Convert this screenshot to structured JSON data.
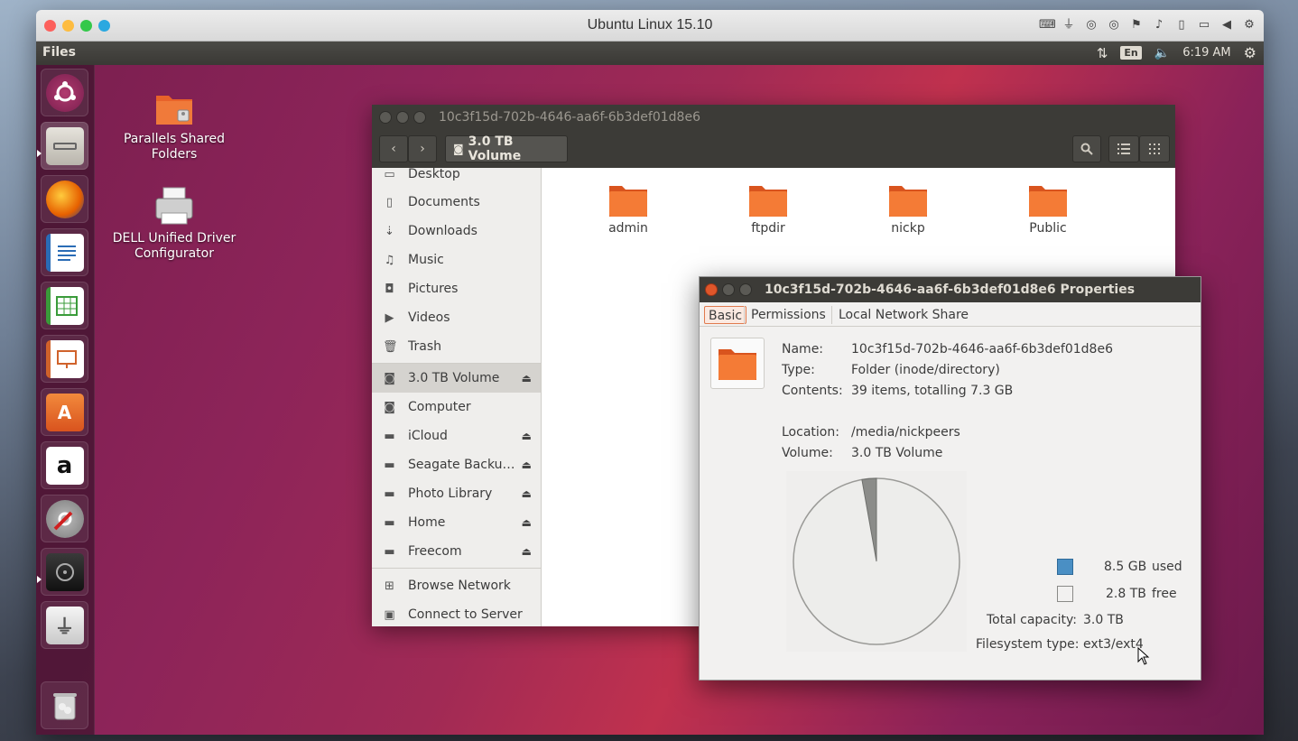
{
  "mac": {
    "title": "Ubuntu Linux 15.10"
  },
  "panel": {
    "app_name": "Files",
    "lang": "En",
    "time": "6:19 AM"
  },
  "desktop_icons": [
    {
      "label_line1": "Parallels Shared",
      "label_line2": "Folders"
    },
    {
      "label_line1": "DELL Unified Driver",
      "label_line2": "Configurator"
    }
  ],
  "launcher": [
    {
      "name": "ubuntu-dash-icon"
    },
    {
      "name": "files-icon"
    },
    {
      "name": "firefox-icon"
    },
    {
      "name": "writer-icon"
    },
    {
      "name": "calc-icon"
    },
    {
      "name": "impress-icon"
    },
    {
      "name": "software-center-icon"
    },
    {
      "name": "amazon-icon"
    },
    {
      "name": "system-settings-icon"
    },
    {
      "name": "disk-drive-icon"
    },
    {
      "name": "usb-drive-icon"
    },
    {
      "name": "trash-icon"
    }
  ],
  "files": {
    "window_title": "10c3f15d-702b-4646-aa6f-6b3def01d8e6",
    "path_label": "3.0 TB Volume",
    "sidebar": [
      {
        "label": "Desktop",
        "icon": "folder-icon"
      },
      {
        "label": "Documents",
        "icon": "document-icon"
      },
      {
        "label": "Downloads",
        "icon": "download-icon"
      },
      {
        "label": "Music",
        "icon": "music-icon"
      },
      {
        "label": "Pictures",
        "icon": "camera-icon"
      },
      {
        "label": "Videos",
        "icon": "video-icon"
      },
      {
        "label": "Trash",
        "icon": "trash-icon"
      },
      {
        "label": "3.0 TB Volume",
        "icon": "drive-icon",
        "eject": true,
        "active": true
      },
      {
        "label": "Computer",
        "icon": "computer-icon"
      },
      {
        "label": "iCloud",
        "icon": "drive-icon",
        "eject": true
      },
      {
        "label": "Seagate Backu…",
        "icon": "drive-icon",
        "eject": true
      },
      {
        "label": "Photo Library",
        "icon": "drive-icon",
        "eject": true
      },
      {
        "label": "Home",
        "icon": "drive-icon",
        "eject": true
      },
      {
        "label": "Freecom",
        "icon": "drive-icon",
        "eject": true
      },
      {
        "label": "Browse Network",
        "icon": "network-icon"
      },
      {
        "label": "Connect to Server",
        "icon": "server-icon"
      }
    ],
    "folders": [
      "admin",
      "ftpdir",
      "nickp",
      "Public"
    ]
  },
  "properties": {
    "title": "10c3f15d-702b-4646-aa6f-6b3def01d8e6 Properties",
    "tabs": [
      "Basic",
      "Permissions",
      "Local Network Share"
    ],
    "name_label": "Name:",
    "name_value": "10c3f15d-702b-4646-aa6f-6b3def01d8e6",
    "type_label": "Type:",
    "type_value": "Folder (inode/directory)",
    "contents_label": "Contents:",
    "contents_value": "39 items, totalling 7.3 GB",
    "location_label": "Location:",
    "location_value": "/media/nickpeers",
    "volume_label": "Volume:",
    "volume_value": "3.0 TB Volume",
    "used_value": "8.5 GB",
    "used_label": "used",
    "free_value": "2.8 TB",
    "free_label": "free",
    "capacity_label": "Total capacity:",
    "capacity_value": "3.0 TB",
    "fstype_label": "Filesystem type:",
    "fstype_value": "ext3/ext4",
    "used_fraction": 0.028,
    "colors": {
      "used": "#4a8fc4",
      "free": "#f2f1f0",
      "pie_fill": "#ededeb",
      "pie_slice": "#8b8c89"
    }
  }
}
